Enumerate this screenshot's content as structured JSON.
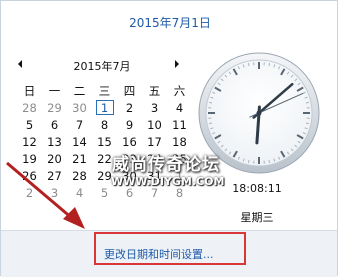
{
  "header": {
    "date_title": "2015年7月1日"
  },
  "calendar": {
    "month_title": "2015年7月",
    "weekdays": [
      "日",
      "一",
      "二",
      "三",
      "四",
      "五",
      "六"
    ],
    "weeks": [
      [
        {
          "d": "28",
          "o": true
        },
        {
          "d": "29",
          "o": true
        },
        {
          "d": "30",
          "o": true
        },
        {
          "d": "1",
          "t": true
        },
        {
          "d": "2"
        },
        {
          "d": "3"
        },
        {
          "d": "4"
        }
      ],
      [
        {
          "d": "5"
        },
        {
          "d": "6"
        },
        {
          "d": "7"
        },
        {
          "d": "8"
        },
        {
          "d": "9"
        },
        {
          "d": "10"
        },
        {
          "d": "11"
        }
      ],
      [
        {
          "d": "12"
        },
        {
          "d": "13"
        },
        {
          "d": "14"
        },
        {
          "d": "15"
        },
        {
          "d": "16"
        },
        {
          "d": "17"
        },
        {
          "d": "18"
        }
      ],
      [
        {
          "d": "19"
        },
        {
          "d": "20"
        },
        {
          "d": "21"
        },
        {
          "d": "22"
        },
        {
          "d": "23"
        },
        {
          "d": "24"
        },
        {
          "d": "25"
        }
      ],
      [
        {
          "d": "26"
        },
        {
          "d": "27"
        },
        {
          "d": "28"
        },
        {
          "d": "29"
        },
        {
          "d": "30"
        },
        {
          "d": "31"
        },
        {
          "d": "1",
          "o": true
        }
      ],
      [
        {
          "d": "2",
          "o": true
        },
        {
          "d": "3",
          "o": true
        },
        {
          "d": "4",
          "o": true
        },
        {
          "d": "5",
          "o": true
        },
        {
          "d": "6",
          "o": true
        },
        {
          "d": "7",
          "o": true
        },
        {
          "d": "8",
          "o": true
        }
      ]
    ]
  },
  "clock": {
    "time_text": "18:08:11",
    "weekday_text": "星期三",
    "hours": 18,
    "minutes": 8,
    "seconds": 11
  },
  "watermark": {
    "title": "威尚传奇论坛",
    "url": "WWW.DIYGM.COM"
  },
  "footer": {
    "settings_link": "更改日期和时间设置..."
  },
  "colors": {
    "accent": "#1e5aa8",
    "highlight_box": "#d9363a",
    "arrow": "#b32020"
  },
  "icons": [
    "prev-month-icon",
    "next-month-icon",
    "analog-clock-icon",
    "red-pointer-arrow-icon"
  ]
}
